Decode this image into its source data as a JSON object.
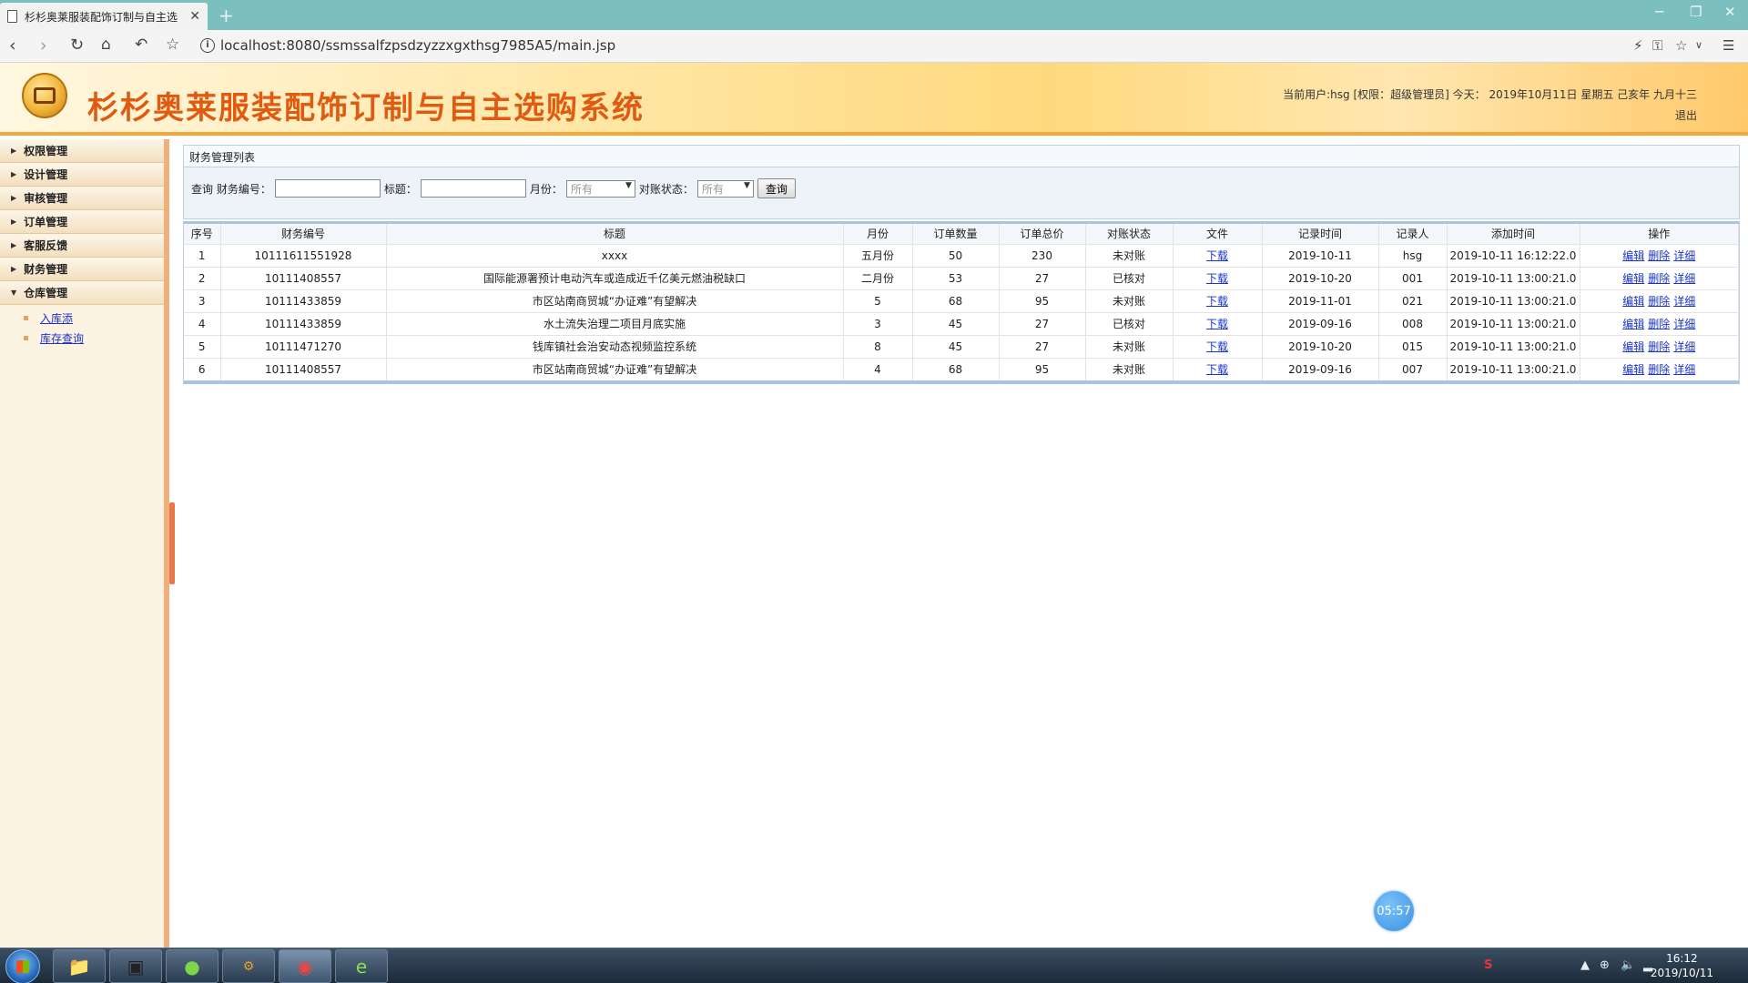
{
  "browser": {
    "tab_title": "杉杉奥莱服装配饰订制与自主选",
    "url": "localhost:8080/ssmssalfzpsdzyzzxgxthsg7985A5/main.jsp"
  },
  "header": {
    "title": "杉杉奥莱服装配饰订制与自主选购系统",
    "user_info": "当前用户:hsg [权限：超级管理员] 今天： 2019年10月11日 星期五 己亥年 九月十三",
    "logout": "退出"
  },
  "sidebar": {
    "items": [
      {
        "label": "权限管理"
      },
      {
        "label": "设计管理"
      },
      {
        "label": "审核管理"
      },
      {
        "label": "订单管理"
      },
      {
        "label": "客服反馈"
      },
      {
        "label": "财务管理"
      },
      {
        "label": "仓库管理"
      }
    ],
    "sub_items": [
      {
        "label": "入库添"
      },
      {
        "label": "库存查询"
      }
    ]
  },
  "panel": {
    "title": "财务管理列表"
  },
  "search": {
    "label_query": "查询 财务编号：",
    "label_title": "标题：",
    "label_month": "月份：",
    "month_value": "所有",
    "label_status": "对账状态：",
    "status_value": "所有",
    "button": "查询"
  },
  "table": {
    "headers": [
      "序号",
      "财务编号",
      "标题",
      "月份",
      "订单数量",
      "订单总价",
      "对账状态",
      "文件",
      "记录时间",
      "记录人",
      "添加时间",
      "操作"
    ],
    "rows": [
      {
        "no": "1",
        "code": "10111611551928",
        "title": "xxxx",
        "month": "五月份",
        "qty": "50",
        "total": "230",
        "status": "未对账",
        "file": "下载",
        "record_date": "2019-10-11",
        "recorder": "hsg",
        "added": "2019-10-11 16:12:22.0"
      },
      {
        "no": "2",
        "code": "10111408557",
        "title": "国际能源署预计电动汽车或造成近千亿美元燃油税缺口",
        "month": "二月份",
        "qty": "53",
        "total": "27",
        "status": "已核对",
        "file": "下载",
        "record_date": "2019-10-20",
        "recorder": "001",
        "added": "2019-10-11 13:00:21.0"
      },
      {
        "no": "3",
        "code": "10111433859",
        "title": "市区站南商贸城“办证难”有望解决",
        "month": "5",
        "qty": "68",
        "total": "95",
        "status": "未对账",
        "file": "下载",
        "record_date": "2019-11-01",
        "recorder": "021",
        "added": "2019-10-11 13:00:21.0"
      },
      {
        "no": "4",
        "code": "10111433859",
        "title": "水土流失治理二项目月底实施",
        "month": "3",
        "qty": "45",
        "total": "27",
        "status": "已核对",
        "file": "下载",
        "record_date": "2019-09-16",
        "recorder": "008",
        "added": "2019-10-11 13:00:21.0"
      },
      {
        "no": "5",
        "code": "10111471270",
        "title": "钱库镇社会治安动态视频监控系统",
        "month": "8",
        "qty": "45",
        "total": "27",
        "status": "未对账",
        "file": "下载",
        "record_date": "2019-10-20",
        "recorder": "015",
        "added": "2019-10-11 13:00:21.0"
      },
      {
        "no": "6",
        "code": "10111408557",
        "title": "市区站南商贸城“办证难”有望解决",
        "month": "4",
        "qty": "68",
        "total": "95",
        "status": "未对账",
        "file": "下载",
        "record_date": "2019-09-16",
        "recorder": "007",
        "added": "2019-10-11 13:00:21.0"
      }
    ],
    "ops": {
      "edit": "编辑",
      "delete": "删除",
      "detail": "详细"
    }
  },
  "timer": "05:57",
  "taskbar": {
    "time": "16:12",
    "date": "2019/10/11",
    "apps": [
      "file-explorer-icon",
      "app-window-icon",
      "green-app-icon",
      "java-ee-icon",
      "chrome-icon",
      "green-e-icon"
    ]
  }
}
